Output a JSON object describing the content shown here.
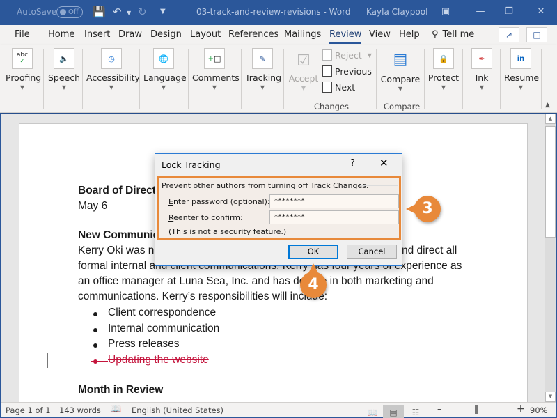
{
  "titlebar": {
    "autosave_label": "AutoSave",
    "autosave_state": "Off",
    "document_title": "03-track-and-review-revisions - Word",
    "user_name": "Kayla Claypool"
  },
  "menu": {
    "tabs": [
      {
        "label": "File"
      },
      {
        "label": "Home"
      },
      {
        "label": "Insert"
      },
      {
        "label": "Draw"
      },
      {
        "label": "Design"
      },
      {
        "label": "Layout"
      },
      {
        "label": "References"
      },
      {
        "label": "Mailings"
      },
      {
        "label": "Review"
      },
      {
        "label": "View"
      },
      {
        "label": "Help"
      }
    ],
    "active_tab": "Review",
    "tell_me": "Tell me"
  },
  "ribbon": {
    "proofing": "Proofing",
    "proofing_icon_text": "abc",
    "speech": "Speech",
    "accessibility": "Accessibility",
    "language": "Language",
    "comments": "Comments",
    "tracking": "Tracking",
    "accept": "Accept",
    "reject": "Reject",
    "previous": "Previous",
    "next": "Next",
    "changes_group": "Changes",
    "compare": "Compare",
    "compare_group": "Compare",
    "protect": "Protect",
    "ink": "Ink",
    "resume": "Resume"
  },
  "document": {
    "heading1": "Board of Directo",
    "date": "May 6",
    "heading2": "New Communic",
    "para_line1_left": "Kerry Oki was na",
    "para_line1_right": "nd direct all",
    "para_line2": "formal internal and client communications. Kerry has four years of experience as",
    "para_line3": "an office manager at Luna Sea, Inc. and has degree in both marketing and",
    "para_line4": "communications. Kerry’s responsibilities will include:",
    "bullets": [
      {
        "text": "Client correspondence",
        "deleted": false
      },
      {
        "text": "Internal communication",
        "deleted": false
      },
      {
        "text": "Press releases",
        "deleted": false
      },
      {
        "text": "Updating the website",
        "deleted": true
      }
    ],
    "heading3": "Month in Review"
  },
  "dialog": {
    "title": "Lock Tracking",
    "help": "?",
    "description": "Prevent other authors from turning off Track Changes.",
    "password_label_accel": "E",
    "password_label_rest": "nter password (optional):",
    "password_value": "********",
    "confirm_label_accel": "R",
    "confirm_label_rest": "eenter to confirm:",
    "confirm_value": "********",
    "note": "(This is not a security feature.)",
    "ok": "OK",
    "cancel": "Cancel"
  },
  "callouts": {
    "step3": "3",
    "step4": "4",
    "color": "#e8893a"
  },
  "statusbar": {
    "page": "Page 1 of 1",
    "words": "143 words",
    "language": "English (United States)",
    "zoom": "90%",
    "zoom_percent": 90
  }
}
